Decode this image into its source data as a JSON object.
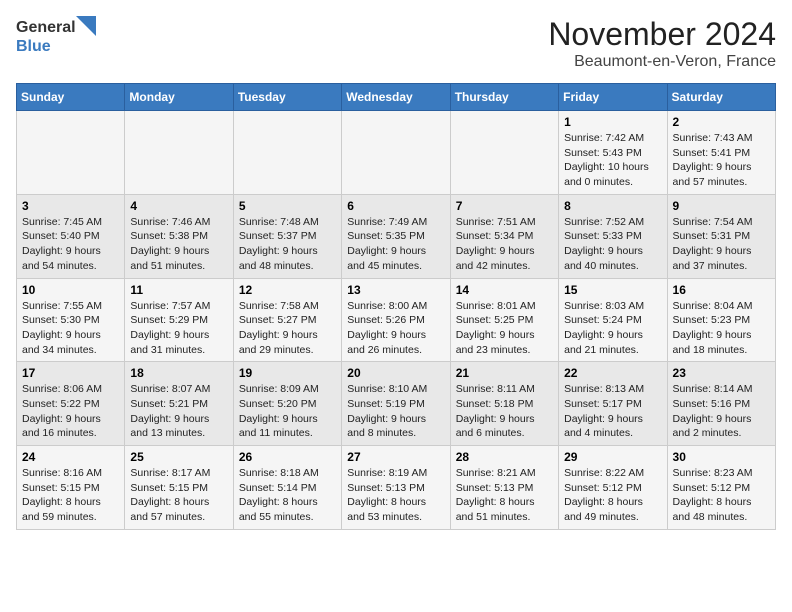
{
  "logo": {
    "line1": "General",
    "line2": "Blue"
  },
  "title": "November 2024",
  "subtitle": "Beaumont-en-Veron, France",
  "days_of_week": [
    "Sunday",
    "Monday",
    "Tuesday",
    "Wednesday",
    "Thursday",
    "Friday",
    "Saturday"
  ],
  "weeks": [
    [
      {
        "day": "",
        "info": ""
      },
      {
        "day": "",
        "info": ""
      },
      {
        "day": "",
        "info": ""
      },
      {
        "day": "",
        "info": ""
      },
      {
        "day": "",
        "info": ""
      },
      {
        "day": "1",
        "info": "Sunrise: 7:42 AM\nSunset: 5:43 PM\nDaylight: 10 hours and 0 minutes."
      },
      {
        "day": "2",
        "info": "Sunrise: 7:43 AM\nSunset: 5:41 PM\nDaylight: 9 hours and 57 minutes."
      }
    ],
    [
      {
        "day": "3",
        "info": "Sunrise: 7:45 AM\nSunset: 5:40 PM\nDaylight: 9 hours and 54 minutes."
      },
      {
        "day": "4",
        "info": "Sunrise: 7:46 AM\nSunset: 5:38 PM\nDaylight: 9 hours and 51 minutes."
      },
      {
        "day": "5",
        "info": "Sunrise: 7:48 AM\nSunset: 5:37 PM\nDaylight: 9 hours and 48 minutes."
      },
      {
        "day": "6",
        "info": "Sunrise: 7:49 AM\nSunset: 5:35 PM\nDaylight: 9 hours and 45 minutes."
      },
      {
        "day": "7",
        "info": "Sunrise: 7:51 AM\nSunset: 5:34 PM\nDaylight: 9 hours and 42 minutes."
      },
      {
        "day": "8",
        "info": "Sunrise: 7:52 AM\nSunset: 5:33 PM\nDaylight: 9 hours and 40 minutes."
      },
      {
        "day": "9",
        "info": "Sunrise: 7:54 AM\nSunset: 5:31 PM\nDaylight: 9 hours and 37 minutes."
      }
    ],
    [
      {
        "day": "10",
        "info": "Sunrise: 7:55 AM\nSunset: 5:30 PM\nDaylight: 9 hours and 34 minutes."
      },
      {
        "day": "11",
        "info": "Sunrise: 7:57 AM\nSunset: 5:29 PM\nDaylight: 9 hours and 31 minutes."
      },
      {
        "day": "12",
        "info": "Sunrise: 7:58 AM\nSunset: 5:27 PM\nDaylight: 9 hours and 29 minutes."
      },
      {
        "day": "13",
        "info": "Sunrise: 8:00 AM\nSunset: 5:26 PM\nDaylight: 9 hours and 26 minutes."
      },
      {
        "day": "14",
        "info": "Sunrise: 8:01 AM\nSunset: 5:25 PM\nDaylight: 9 hours and 23 minutes."
      },
      {
        "day": "15",
        "info": "Sunrise: 8:03 AM\nSunset: 5:24 PM\nDaylight: 9 hours and 21 minutes."
      },
      {
        "day": "16",
        "info": "Sunrise: 8:04 AM\nSunset: 5:23 PM\nDaylight: 9 hours and 18 minutes."
      }
    ],
    [
      {
        "day": "17",
        "info": "Sunrise: 8:06 AM\nSunset: 5:22 PM\nDaylight: 9 hours and 16 minutes."
      },
      {
        "day": "18",
        "info": "Sunrise: 8:07 AM\nSunset: 5:21 PM\nDaylight: 9 hours and 13 minutes."
      },
      {
        "day": "19",
        "info": "Sunrise: 8:09 AM\nSunset: 5:20 PM\nDaylight: 9 hours and 11 minutes."
      },
      {
        "day": "20",
        "info": "Sunrise: 8:10 AM\nSunset: 5:19 PM\nDaylight: 9 hours and 8 minutes."
      },
      {
        "day": "21",
        "info": "Sunrise: 8:11 AM\nSunset: 5:18 PM\nDaylight: 9 hours and 6 minutes."
      },
      {
        "day": "22",
        "info": "Sunrise: 8:13 AM\nSunset: 5:17 PM\nDaylight: 9 hours and 4 minutes."
      },
      {
        "day": "23",
        "info": "Sunrise: 8:14 AM\nSunset: 5:16 PM\nDaylight: 9 hours and 2 minutes."
      }
    ],
    [
      {
        "day": "24",
        "info": "Sunrise: 8:16 AM\nSunset: 5:15 PM\nDaylight: 8 hours and 59 minutes."
      },
      {
        "day": "25",
        "info": "Sunrise: 8:17 AM\nSunset: 5:15 PM\nDaylight: 8 hours and 57 minutes."
      },
      {
        "day": "26",
        "info": "Sunrise: 8:18 AM\nSunset: 5:14 PM\nDaylight: 8 hours and 55 minutes."
      },
      {
        "day": "27",
        "info": "Sunrise: 8:19 AM\nSunset: 5:13 PM\nDaylight: 8 hours and 53 minutes."
      },
      {
        "day": "28",
        "info": "Sunrise: 8:21 AM\nSunset: 5:13 PM\nDaylight: 8 hours and 51 minutes."
      },
      {
        "day": "29",
        "info": "Sunrise: 8:22 AM\nSunset: 5:12 PM\nDaylight: 8 hours and 49 minutes."
      },
      {
        "day": "30",
        "info": "Sunrise: 8:23 AM\nSunset: 5:12 PM\nDaylight: 8 hours and 48 minutes."
      }
    ]
  ]
}
